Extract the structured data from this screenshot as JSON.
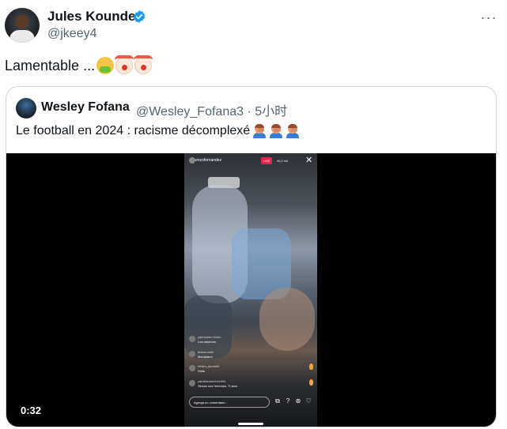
{
  "tweet": {
    "author_name": "Jules Kounde",
    "author_handle": "@jkeey4",
    "text": "Lamentable ...",
    "emojis": [
      "nauseated-face",
      "clown-face",
      "clown-face"
    ]
  },
  "quote": {
    "author_name": "Wesley Fofana",
    "meta": "@Wesley_Fofana3 · 5小时",
    "text": "Le football en 2024 : racisme décomplexé",
    "emojis": [
      "person-facepalming",
      "person-facepalming",
      "person-facepalming"
    ]
  },
  "video": {
    "time": "0:32",
    "live_overlay": {
      "username": "enzofernandez",
      "live_badge": "LIVE",
      "viewers": "40,2 mil",
      "comments": [
        {
          "user": "yael.karen.flores",
          "text": "Los amamos"
        },
        {
          "user": "teclas.mele",
          "text": "Mendiamo"
        },
        {
          "user": "milam_dumbell",
          "text": "Holis"
        },
        {
          "user": "yamilaesanchez904",
          "text": "Sinsos sos hermoso. Ti amo"
        }
      ],
      "input_placeholder": "Agrega un comentario..."
    }
  },
  "colors": {
    "text_primary": "#0f1419",
    "text_secondary": "#536471",
    "border": "#cfd9de",
    "verified_blue": "#1d9bf0",
    "live_red": "#e4254b"
  },
  "icons": [
    "verified-icon",
    "more-icon",
    "close-icon",
    "share-icon",
    "question-icon",
    "gift-icon",
    "heart-icon"
  ]
}
